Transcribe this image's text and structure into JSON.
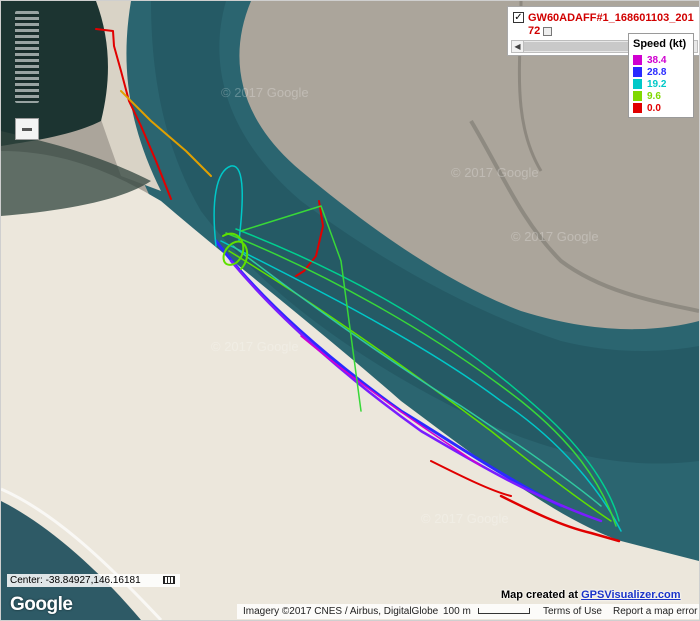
{
  "track": {
    "checked": true,
    "check_mark": "✓",
    "name": "GW60ADAFF#1_168601103_20172",
    "open_icon": "external-window-icon"
  },
  "legend": {
    "title": "Speed (kt)",
    "items": [
      {
        "label": "38.4",
        "color": "#d000d0"
      },
      {
        "label": "28.8",
        "color": "#2a2aff"
      },
      {
        "label": "19.2",
        "color": "#00c8c8"
      },
      {
        "label": "9.6",
        "color": "#80d800"
      },
      {
        "label": "0.0",
        "color": "#e00000"
      }
    ]
  },
  "map": {
    "center": "Center: -38.84927,146.16181",
    "google_logo": "Google",
    "created_prefix": "Map created at ",
    "created_link": "GPSVisualizer.com",
    "imagery": "Imagery ©2017 CNES / Airbus, DigitalGlobe",
    "scale_label": "100 m",
    "terms": "Terms of Use",
    "report": "Report a map error",
    "colors": {
      "water": "#2b6570",
      "sand": "#ece7dc",
      "tidal_flat": "#aba59b",
      "vegetation": "#1c3431",
      "ocean": "#2e5a66"
    }
  }
}
